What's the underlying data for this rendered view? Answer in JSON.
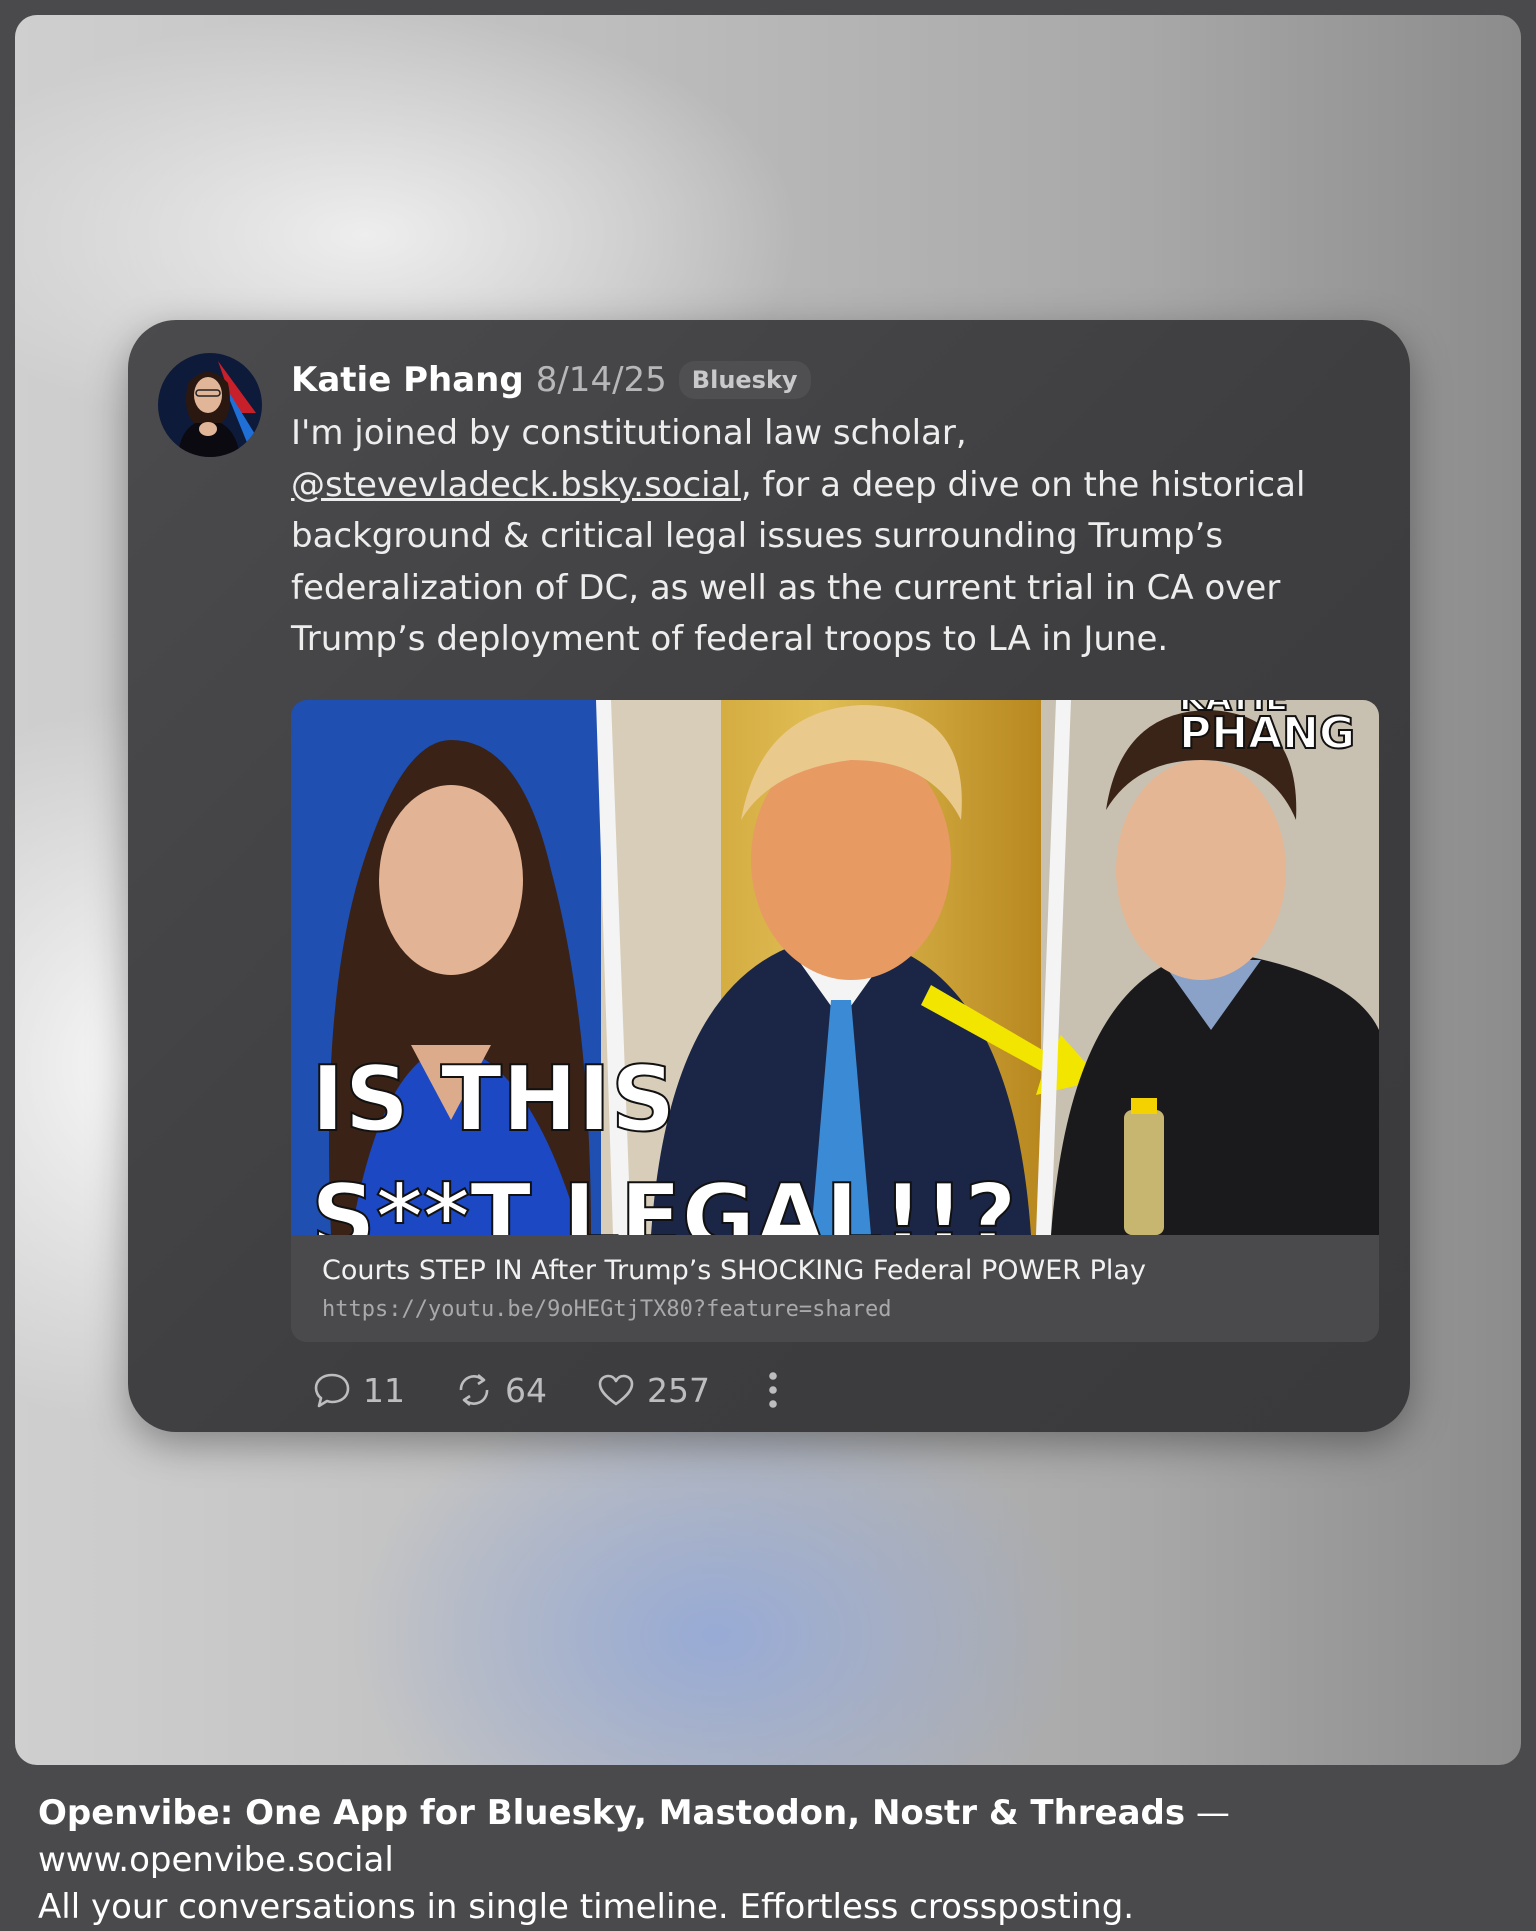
{
  "post": {
    "author": "Katie Phang",
    "date": "8/14/25",
    "platform_badge": "Bluesky",
    "text_before_mention": "I'm joined by constitutional law scholar, ",
    "mention": "@stevevladeck.bsky.social",
    "text_after_mention": ", for a deep dive on the historical background & critical legal issues surrounding Trump’s federalization of DC, as well as the current trial in CA over Trump’s deployment of federal troops to LA in June.",
    "link_card": {
      "thumbnail_caption_line1": "IS THIS",
      "thumbnail_caption_line2": "S**T LEGAL!!?",
      "thumbnail_brand": "KATIE PHANG",
      "title": "Courts STEP IN After Trump’s SHOCKING Federal POWER Play",
      "url": "https://youtu.be/9oHEGtjTX80?feature=shared"
    },
    "stats": {
      "replies": "11",
      "reposts": "64",
      "likes": "257"
    },
    "icons": [
      "reply-icon",
      "repost-icon",
      "like-icon",
      "more-icon"
    ]
  },
  "footer": {
    "headline": "Openvibe: One App for Bluesky, Mastodon, Nostr & Threads",
    "separator": " — ",
    "site": "www.openvibe.social",
    "tagline": "All your conversations in single timeline. Effortless crossposting."
  },
  "colors": {
    "card_bg": "#404042",
    "accent_yellow": "#f2e600",
    "footer_bg": "#4a4a4c"
  }
}
